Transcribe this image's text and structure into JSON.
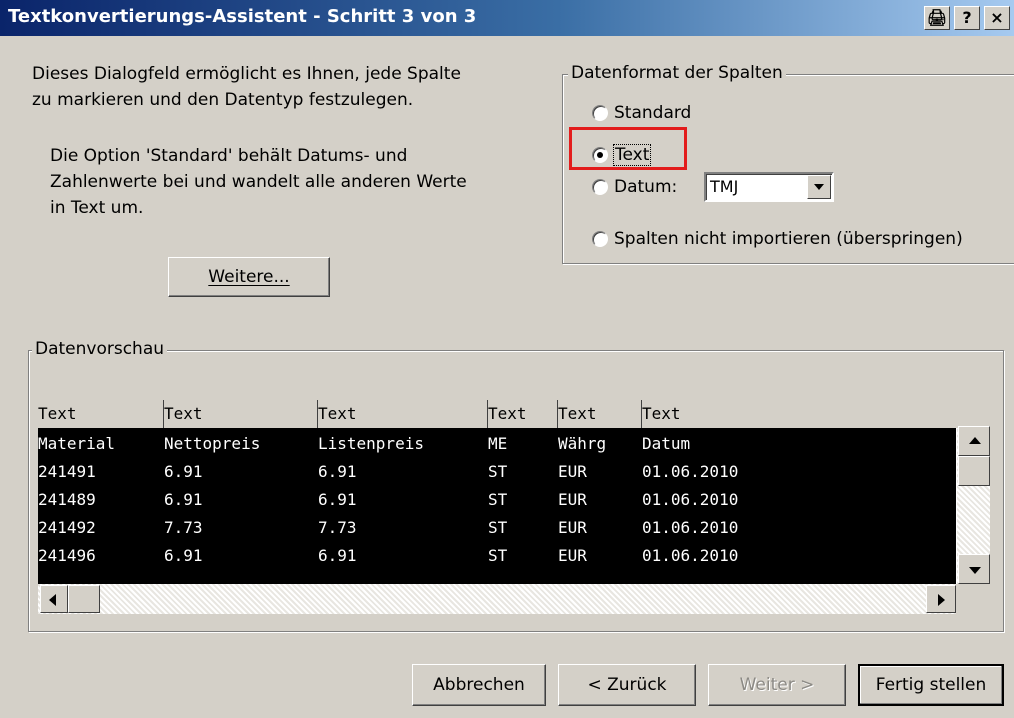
{
  "window": {
    "title": "Textkonvertierungs-Assistent - Schritt 3 von 3",
    "print_button": "🖨",
    "help_button": "?",
    "close_button": "×"
  },
  "description": {
    "line1": "Dieses Dialogfeld ermöglicht es Ihnen, jede Spalte",
    "line2": "zu markieren und den Datentyp festzulegen.",
    "hint1": "Die Option 'Standard' behält Datums- und",
    "hint2": "Zahlenwerte bei und wandelt alle anderen Werte",
    "hint3": "in Text um.",
    "more_button": "Weitere..."
  },
  "column_format": {
    "legend": "Datenformat der Spalten",
    "options": [
      "Standard",
      "Text",
      "Datum:",
      "Spalten nicht importieren (überspringen)"
    ],
    "selected": "Text",
    "date_format": "TMJ"
  },
  "preview": {
    "legend": "Datenvorschau",
    "headers": [
      "Text",
      "Text",
      "Text",
      "Text",
      "Text",
      "Text"
    ],
    "rows": [
      [
        "Material",
        "Nettopreis",
        "Listenpreis",
        "ME",
        "Währg",
        "Datum"
      ],
      [
        "241491",
        "6.91",
        "6.91",
        "ST",
        "EUR",
        "01.06.2010"
      ],
      [
        "241489",
        "6.91",
        "6.91",
        "ST",
        "EUR",
        "01.06.2010"
      ],
      [
        "241492",
        "7.73",
        "7.73",
        "ST",
        "EUR",
        "01.06.2010"
      ],
      [
        "241496",
        "6.91",
        "6.91",
        "ST",
        "EUR",
        "01.06.2010"
      ]
    ]
  },
  "buttons": {
    "cancel": "Abbrechen",
    "back": "< Zurück",
    "next": "Weiter >",
    "finish": "Fertig stellen"
  },
  "colors": {
    "titlebar_start": "#0a246a",
    "titlebar_end": "#a6caf0",
    "face": "#d4d0c8",
    "highlight_box": "#e31c1c"
  }
}
